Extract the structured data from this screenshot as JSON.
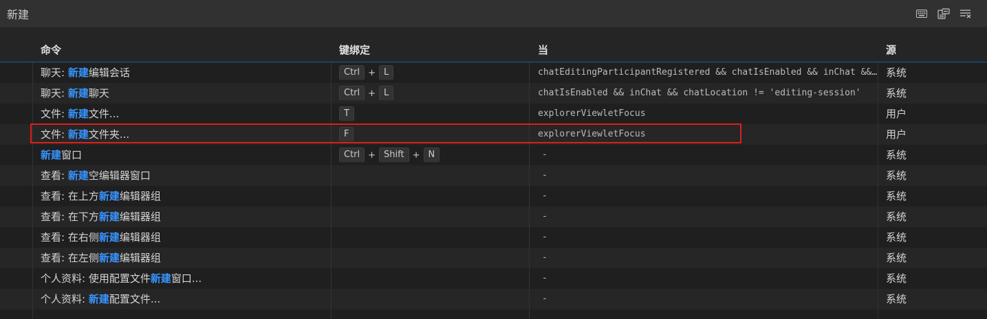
{
  "search": {
    "value": "新建",
    "actions": [
      {
        "name": "record-keys-icon"
      },
      {
        "name": "sort-by-precedence-icon"
      },
      {
        "name": "clear-filter-icon"
      }
    ]
  },
  "columns": {
    "command": "命令",
    "keybinding": "键绑定",
    "when": "当",
    "source": "源"
  },
  "rows": [
    {
      "cmd_pre": "聊天: ",
      "cmd_hl": "新建",
      "cmd_post": "编辑会话",
      "keys": [
        "Ctrl",
        "L"
      ],
      "when": "chatEditingParticipantRegistered && chatIsEnabled && inChat && chatLocation != 'editing-session'",
      "source": "系统"
    },
    {
      "cmd_pre": "聊天: ",
      "cmd_hl": "新建",
      "cmd_post": "聊天",
      "keys": [
        "Ctrl",
        "L"
      ],
      "when": "chatIsEnabled && inChat && chatLocation != 'editing-session'",
      "source": "系统"
    },
    {
      "cmd_pre": "文件: ",
      "cmd_hl": "新建",
      "cmd_post": "文件...",
      "keys": [
        "T"
      ],
      "when": "explorerViewletFocus",
      "source": "用户"
    },
    {
      "cmd_pre": "文件: ",
      "cmd_hl": "新建",
      "cmd_post": "文件夹...",
      "keys": [
        "F"
      ],
      "when": "explorerViewletFocus",
      "source": "用户"
    },
    {
      "cmd_pre": "",
      "cmd_hl": "新建",
      "cmd_post": "窗口",
      "keys": [
        "Ctrl",
        "Shift",
        "N"
      ],
      "when": "-",
      "source": "系统"
    },
    {
      "cmd_pre": "查看: ",
      "cmd_hl": "新建",
      "cmd_post": "空编辑器窗口",
      "keys": [],
      "when": "-",
      "source": "系统"
    },
    {
      "cmd_pre": "查看: 在上方",
      "cmd_hl": "新建",
      "cmd_post": "编辑器组",
      "keys": [],
      "when": "-",
      "source": "系统"
    },
    {
      "cmd_pre": "查看: 在下方",
      "cmd_hl": "新建",
      "cmd_post": "编辑器组",
      "keys": [],
      "when": "-",
      "source": "系统"
    },
    {
      "cmd_pre": "查看: 在右侧",
      "cmd_hl": "新建",
      "cmd_post": "编辑器组",
      "keys": [],
      "when": "-",
      "source": "系统"
    },
    {
      "cmd_pre": "查看: 在左侧",
      "cmd_hl": "新建",
      "cmd_post": "编辑器组",
      "keys": [],
      "when": "-",
      "source": "系统"
    },
    {
      "cmd_pre": "个人资料: 使用配置文件",
      "cmd_hl": "新建",
      "cmd_post": "窗口...",
      "keys": [],
      "when": "-",
      "source": "系统"
    },
    {
      "cmd_pre": "个人资料: ",
      "cmd_hl": "新建",
      "cmd_post": "配置文件...",
      "keys": [],
      "when": "-",
      "source": "系统"
    }
  ],
  "colors": {
    "highlight_text": "#3794ff",
    "annotation_box": "#e01e1e",
    "header_border": "#0e639c"
  }
}
